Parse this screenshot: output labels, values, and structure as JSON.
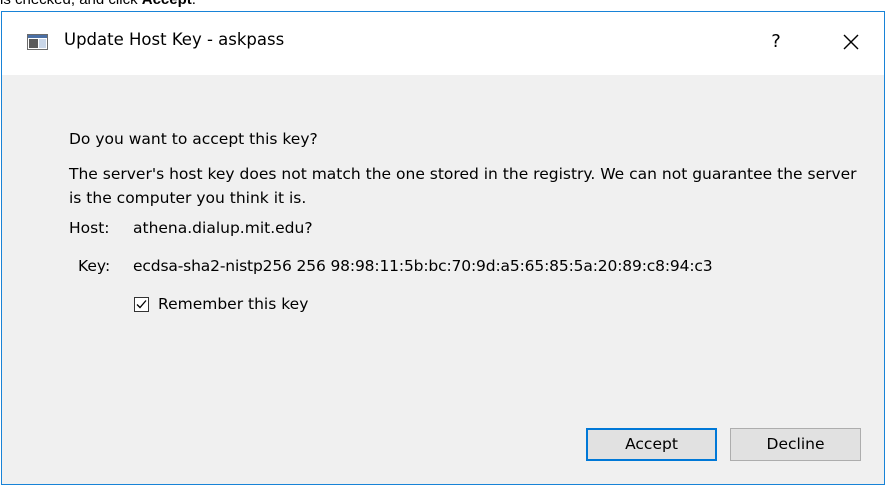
{
  "instruction": {
    "prefix": "is checked, and click ",
    "bold": "Accept",
    "suffix": "."
  },
  "window": {
    "title": "Update Host Key - askpass",
    "help_label": "?",
    "close_icon": "close-icon",
    "app_icon": "window-app-icon"
  },
  "dialog": {
    "question": "Do you want to accept this key?",
    "message": "The server's host key does not match the one stored in the registry. We can not guarantee the server is the computer you think it is.",
    "host_label": "Host:",
    "host_value": "athena.dialup.mit.edu?",
    "key_label": "Key:",
    "key_value": "ecdsa-sha2-nistp256 256 98:98:11:5b:bc:70:9d:a5:65:85:5a:20:89:c8:94:c3",
    "remember_label": "Remember this key",
    "remember_checked": true
  },
  "buttons": {
    "accept": "Accept",
    "decline": "Decline"
  },
  "colors": {
    "window_border": "#1883d7",
    "default_button_border": "#0078d7",
    "dialog_background": "#f0f0f0"
  }
}
